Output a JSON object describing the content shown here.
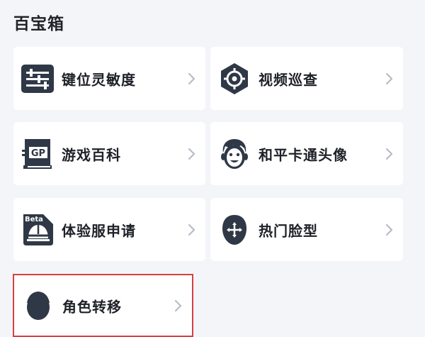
{
  "section_title": "百宝箱",
  "items": [
    {
      "label": "键位灵敏度",
      "icon": "sliders-icon"
    },
    {
      "label": "视频巡查",
      "icon": "crosshair-icon"
    },
    {
      "label": "游戏百科",
      "icon": "gp-book-icon"
    },
    {
      "label": "和平卡通头像",
      "icon": "cartoon-face-icon"
    },
    {
      "label": "体验服申请",
      "icon": "beta-helmet-icon"
    },
    {
      "label": "热门脸型",
      "icon": "face-shape-icon"
    },
    {
      "label": "角色转移",
      "icon": "role-transfer-icon"
    }
  ],
  "colors": {
    "background": "#f3f5f9",
    "card": "#ffffff",
    "icon_dark": "#2f3846",
    "highlight_border": "#d64040",
    "chevron": "#b7bcc5"
  }
}
